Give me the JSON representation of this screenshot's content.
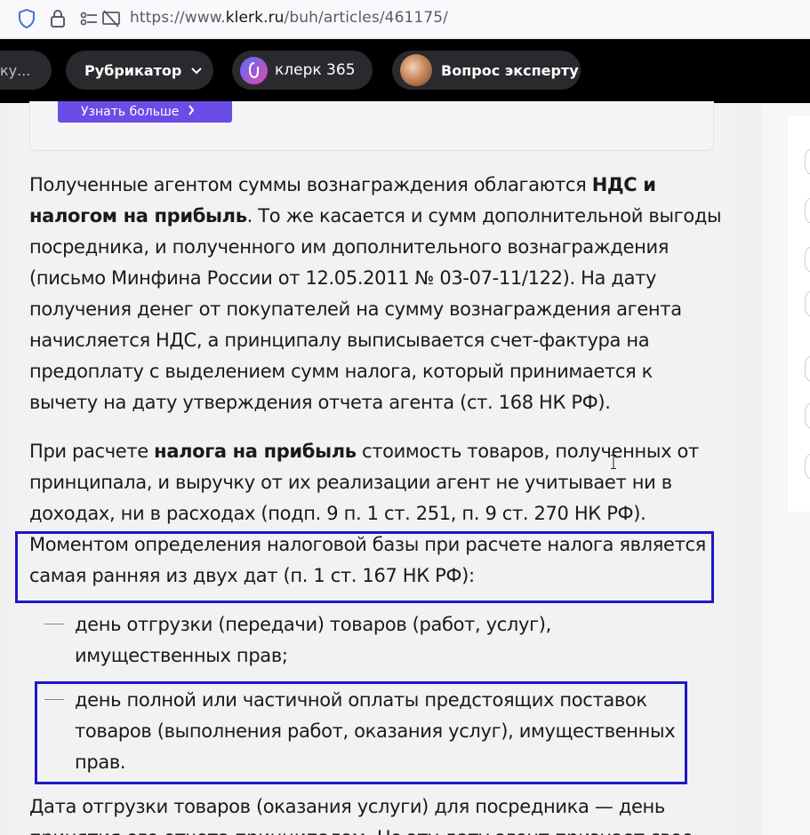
{
  "browser": {
    "url_prefix": "https://www.",
    "url_host": "klerk.ru",
    "url_path": "/buh/articles/461175/"
  },
  "header": {
    "search_stub": "ку...",
    "rubricator": "Рубрикатор",
    "klerk365": "клерк 365",
    "expert": "Вопрос эксперту"
  },
  "promo": {
    "button": "Узнать больше"
  },
  "article": {
    "p1": {
      "t1": "Полученные агентом суммы вознаграждения облагаются ",
      "b1": "НДС и налогом на прибыль",
      "t2": ". То же касается и сумм дополнительной выгоды посредника, и полученного им дополнительного вознаграждения (письмо Минфина России от 12.05.2011 № 03-07-11/122). На дату получения денег от покупателей на сумму вознаграждения агента начисляется НДС, а принципалу выписывается счет-фактура на предоплату с выделением сумм налога, который принимается к вычету на дату утверждения отчета агента (ст. 168 НК РФ)."
    },
    "p2": {
      "t1": "При расчете ",
      "b1": "налога на прибыль",
      "t2": " стоимость товаров, полученных от принципала, и выручку от их реализации агент не учитывает ни в доходах, ни в расходах (подп. 9 п. 1 ст. 251, п. 9 ст. 270 НК РФ)."
    },
    "p3": "Моментом определения налоговой базы при расчете налога является самая ранняя из двух дат (п. 1 ст. 167 НК РФ):",
    "list": [
      "день отгрузки (передачи) товаров (работ, услуг), имущественных прав;",
      "день полной или частичной оплаты предстоящих поставок товаров (выполнения работ, оказания услуг), имущественных прав."
    ],
    "p4": "Дата отгрузки товаров (оказания услуги) для посредника — день принятия его отчета принципалом. Но эту дату агент признает свое"
  },
  "colors": {
    "highlight": "#1e18c8",
    "header_bg": "#000000",
    "promo_button": "#6b4ce6"
  }
}
